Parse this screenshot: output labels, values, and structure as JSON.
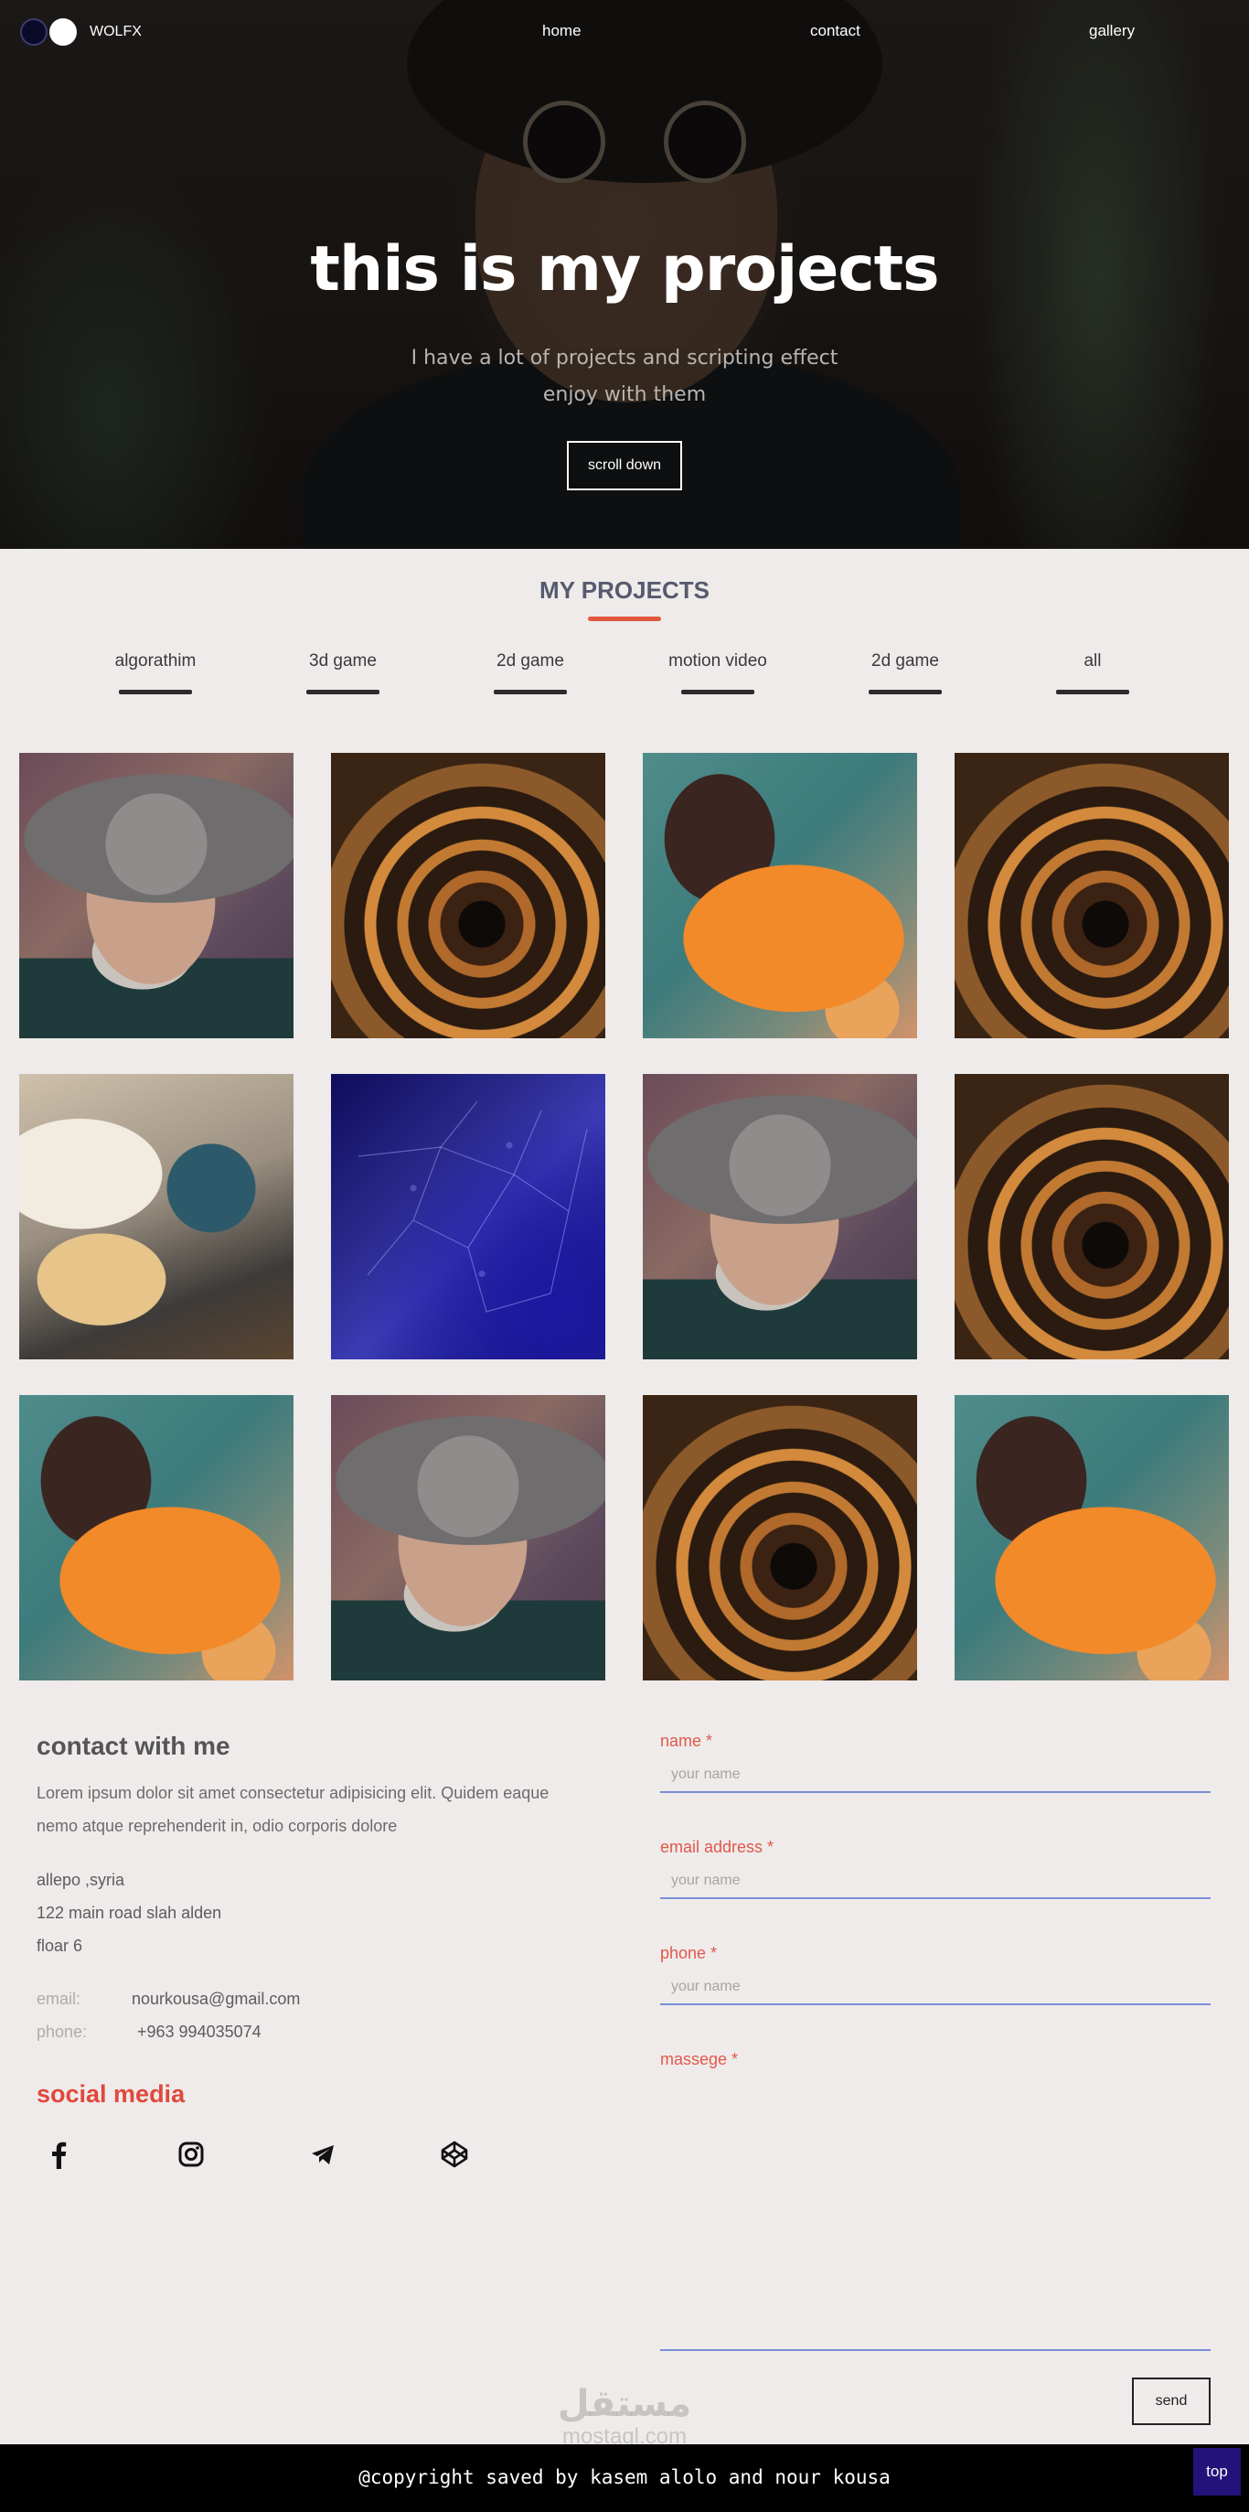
{
  "nav": {
    "logo_text": "WOLFX",
    "home": "home",
    "contact": "contact",
    "gallery": "gallery"
  },
  "hero": {
    "title": "this is my projects",
    "subtitle_line1": "I have a lot of projects and scripting effect",
    "subtitle_line2": "enjoy with them",
    "button": "scroll down"
  },
  "projects": {
    "title": "MY PROJECTS",
    "accent": "#e0583e",
    "filters": [
      "algorathim",
      "3d game",
      "2d game",
      "motion video",
      "2d game",
      "all"
    ],
    "tiles": [
      "man",
      "stair",
      "butterfly",
      "stair",
      "cake",
      "network",
      "man",
      "stair",
      "butterfly",
      "man",
      "stair",
      "butterfly"
    ]
  },
  "contact": {
    "title": "contact with me",
    "text_line1": "Lorem ipsum dolor sit amet consectetur adipisicing elit. Quidem eaque",
    "text_line2": "nemo atque reprehenderit in, odio corporis dolore",
    "address": [
      "allepo ,syria",
      "122 main road slah alden",
      "floar 6"
    ],
    "email_label": "email:",
    "email_value": "nourkousa@gmail.com",
    "phone_label": "phone:",
    "phone_value": "+963 994035074"
  },
  "social": {
    "title": "social media",
    "icons": [
      "facebook-icon",
      "instagram-icon",
      "telegram-icon",
      "codepen-icon"
    ]
  },
  "form": {
    "name_label": "name *",
    "name_placeholder": "your name",
    "email_label": "email address *",
    "email_placeholder": "your name",
    "phone_label": "phone *",
    "phone_placeholder": "your name",
    "message_label": "massege *",
    "send": "send",
    "accent": "#e0584c",
    "line_color": "#7a8fd8"
  },
  "watermark": {
    "arabic": "مستقل",
    "latin": "mostaql.com"
  },
  "footer": {
    "copyright": "@copyright saved by kasem alolo and nour kousa",
    "top_button": "top"
  }
}
